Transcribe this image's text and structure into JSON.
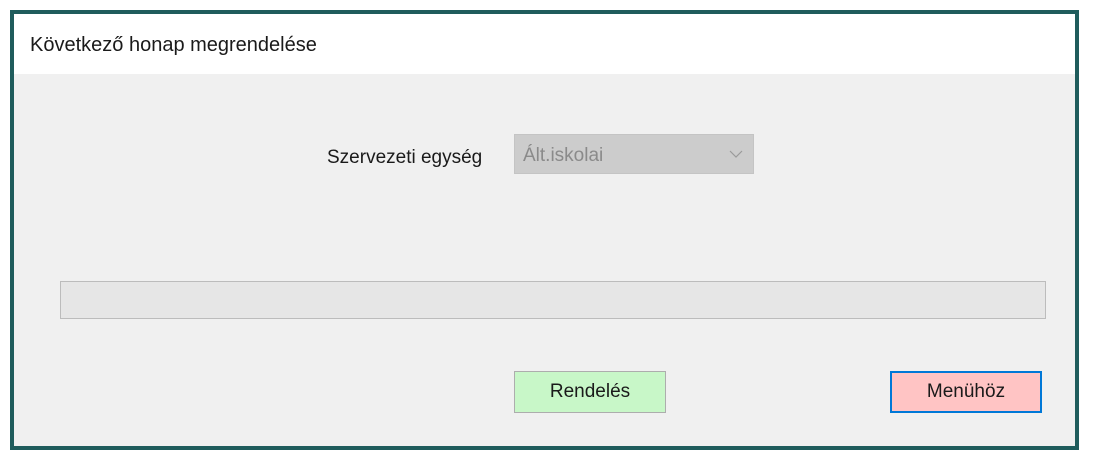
{
  "window": {
    "title": "Következő honap megrendelése"
  },
  "form": {
    "unit_label": "Szervezeti egység",
    "unit_value": "Ált.iskolai",
    "unit_icon": "chevron-down-icon"
  },
  "progress": {
    "value": 0
  },
  "buttons": {
    "order_label": "Rendelés",
    "menu_label": "Menühöz"
  },
  "colors": {
    "window_border": "#1f5c5c",
    "order_button": "#c8f7c8",
    "menu_button": "#ffc4c4",
    "focus_border": "#0078d7"
  }
}
